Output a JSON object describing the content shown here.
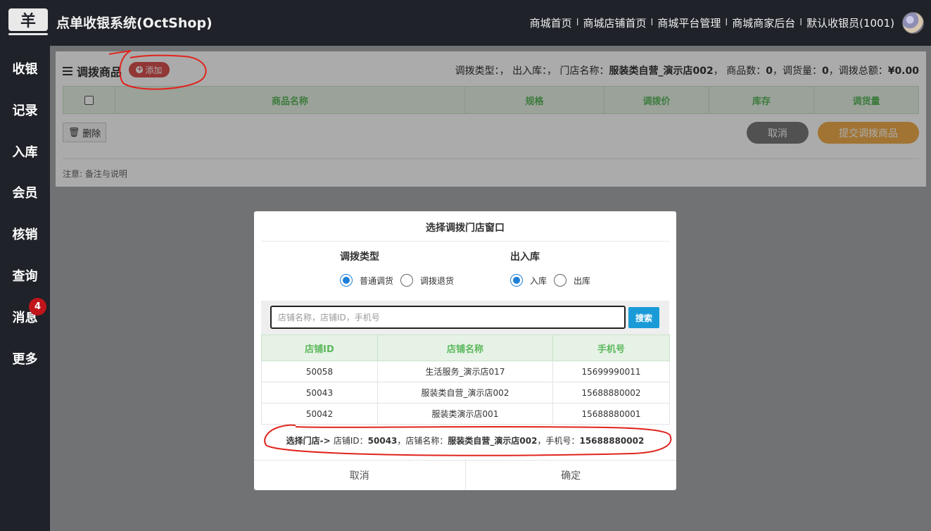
{
  "header": {
    "logo_glyph": "羊",
    "app_title": "点单收银系统(OctShop)",
    "nav": [
      "商城首页",
      "商城店铺首页",
      "商城平台管理",
      "商城商家后台",
      "默认收银员(1001)"
    ],
    "nav_separator": "I"
  },
  "sidebar": {
    "items": [
      {
        "label": "收银"
      },
      {
        "label": "记录"
      },
      {
        "label": "入库"
      },
      {
        "label": "会员"
      },
      {
        "label": "核销"
      },
      {
        "label": "查询"
      },
      {
        "label": "消息",
        "badge": "4"
      },
      {
        "label": "更多"
      }
    ],
    "badge_color": "#c0151b"
  },
  "panel": {
    "title": "调拨商品",
    "add_label": "添加",
    "summary": {
      "type_label": "调拨类型：，",
      "io_label": "出入库：，",
      "store_label": "门店名称：",
      "store_value": "服装类自营_演示店002",
      "goods_count_label": "， 商品数：",
      "goods_count": "0",
      "qty_label": "，调货量：",
      "qty": "0",
      "total_label": "，调拨总额：",
      "total": "¥0.00"
    },
    "columns": [
      "商品名称",
      "规格",
      "调拨价",
      "库存",
      "调货量"
    ],
    "delete_label": "删除",
    "cancel_label": "取消",
    "submit_label": "提交调拨商品",
    "note": "注意: 备注与说明"
  },
  "dialog": {
    "title": "选择调拨门店窗口",
    "transfer_type": {
      "label": "调拨类型",
      "options": [
        "普通调货",
        "调拨退货"
      ],
      "selected": "普通调货"
    },
    "io": {
      "label": "出入库",
      "options": [
        "入库",
        "出库"
      ],
      "selected": "入库"
    },
    "search": {
      "placeholder": "店铺名称，店铺ID，手机号",
      "value": "",
      "button_label": "搜索"
    },
    "table": {
      "columns": [
        "店铺ID",
        "店铺名称",
        "手机号"
      ],
      "rows": [
        [
          "50058",
          "生活服务_演示店017",
          "15699990011"
        ],
        [
          "50043",
          "服装类自营_演示店002",
          "15688880002"
        ],
        [
          "50042",
          "服装类演示店001",
          "15688880001"
        ]
      ]
    },
    "selected": {
      "prefix": "选择门店-> ",
      "id_label": "店铺ID：",
      "id": "50043",
      "name_label": "，店铺名称：",
      "name": "服装类自营_演示店002",
      "phone_label": "，手机号：",
      "phone": "15688880002"
    },
    "cancel_label": "取消",
    "confirm_label": "确定"
  },
  "colors": {
    "header_bg": "#1f2228",
    "add_button": "#d9534f",
    "submit_button": "#f0ad4e",
    "search_button": "#1a9bd7",
    "table_header_text": "#5cb85c",
    "radio_selected": "#1e7fd6",
    "annotation": "#e0241d"
  }
}
